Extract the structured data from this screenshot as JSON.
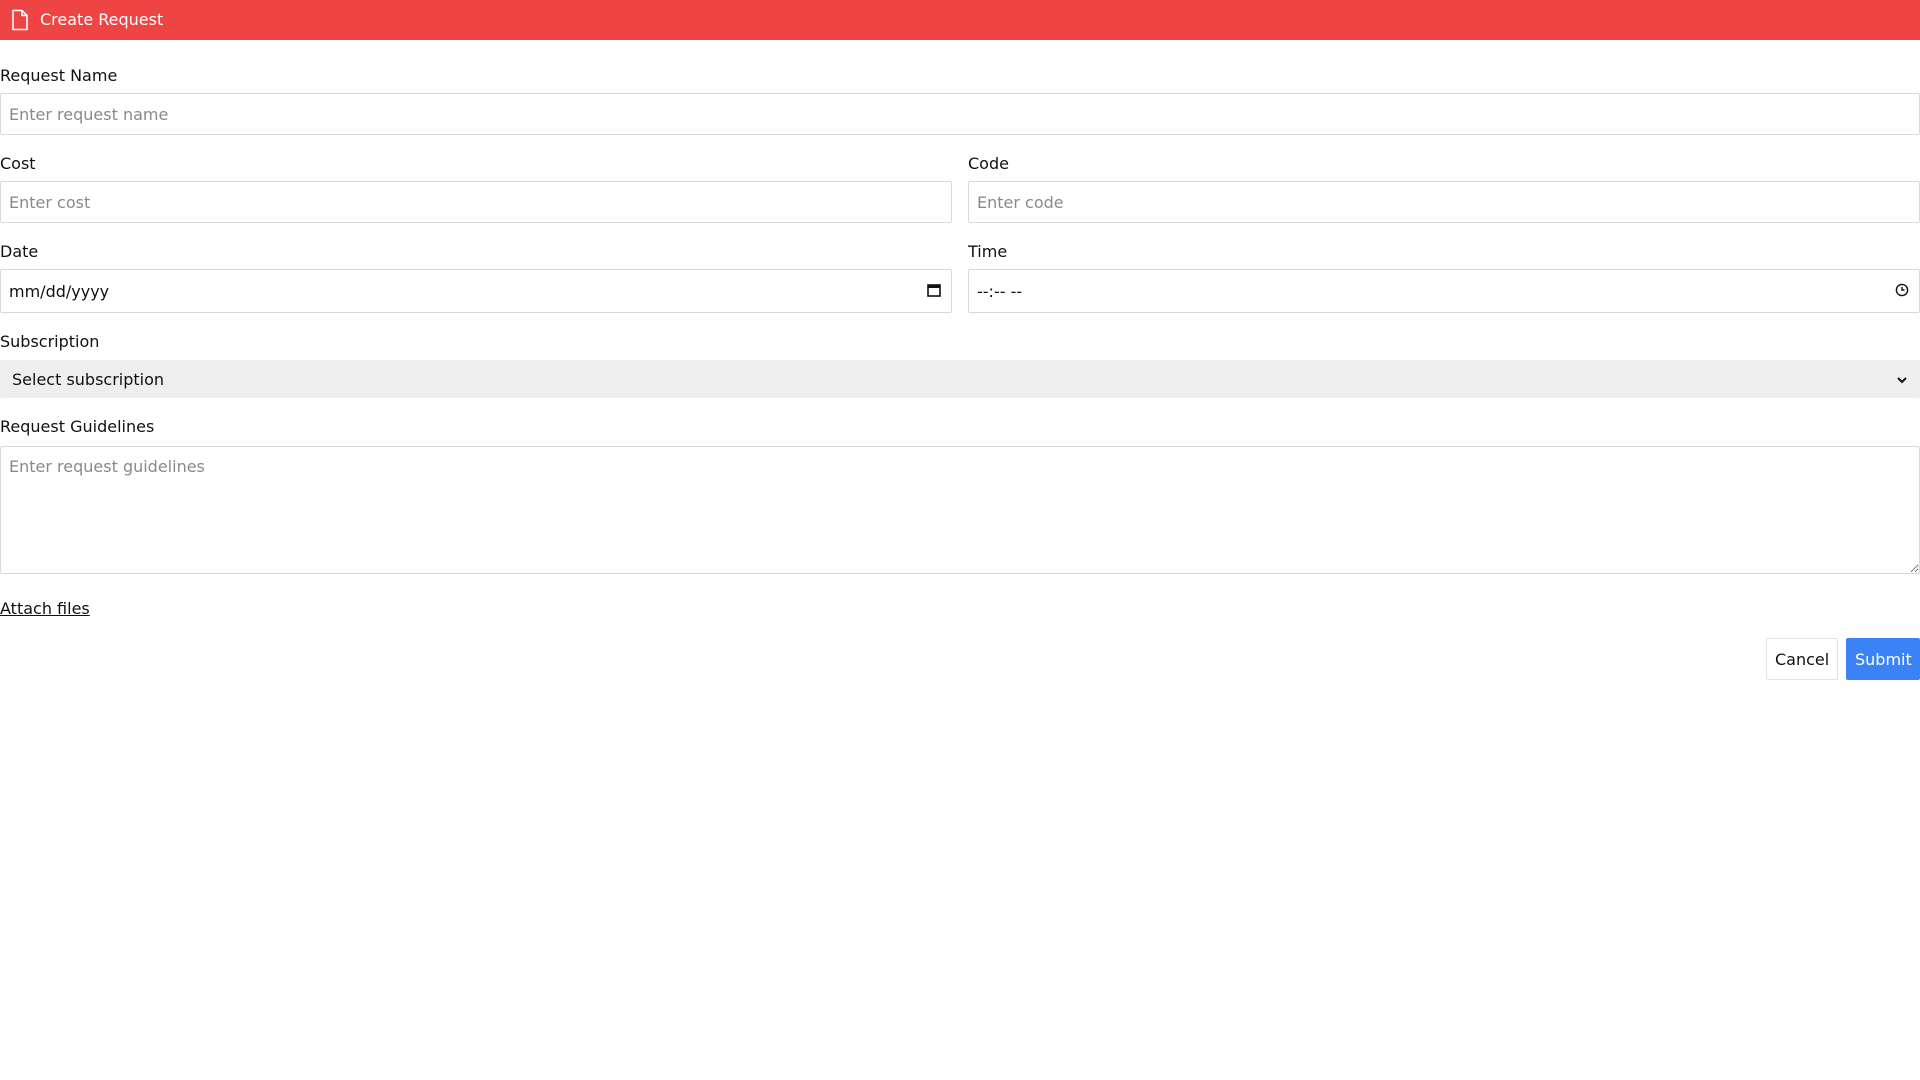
{
  "header": {
    "title": "Create Request",
    "icon": "document-icon",
    "bg_color": "#ef4444"
  },
  "fields": {
    "request_name": {
      "label": "Request Name",
      "placeholder": "Enter request name"
    },
    "cost": {
      "label": "Cost",
      "placeholder": "Enter cost"
    },
    "code": {
      "label": "Code",
      "placeholder": "Enter code"
    },
    "date": {
      "label": "Date",
      "value": "mm/dd/yyyy",
      "icon": "calendar-icon"
    },
    "time": {
      "label": "Time",
      "value": "--:-- --",
      "icon": "clock-icon"
    },
    "subscription": {
      "label": "Subscription",
      "selected": "Select subscription",
      "icon": "chevron-down-icon"
    },
    "guidelines": {
      "label": "Request Guidelines",
      "placeholder": "Enter request guidelines"
    }
  },
  "attach": {
    "label": "Attach files"
  },
  "actions": {
    "cancel_label": "Cancel",
    "submit_label": "Submit",
    "submit_color": "#3b82f6"
  }
}
